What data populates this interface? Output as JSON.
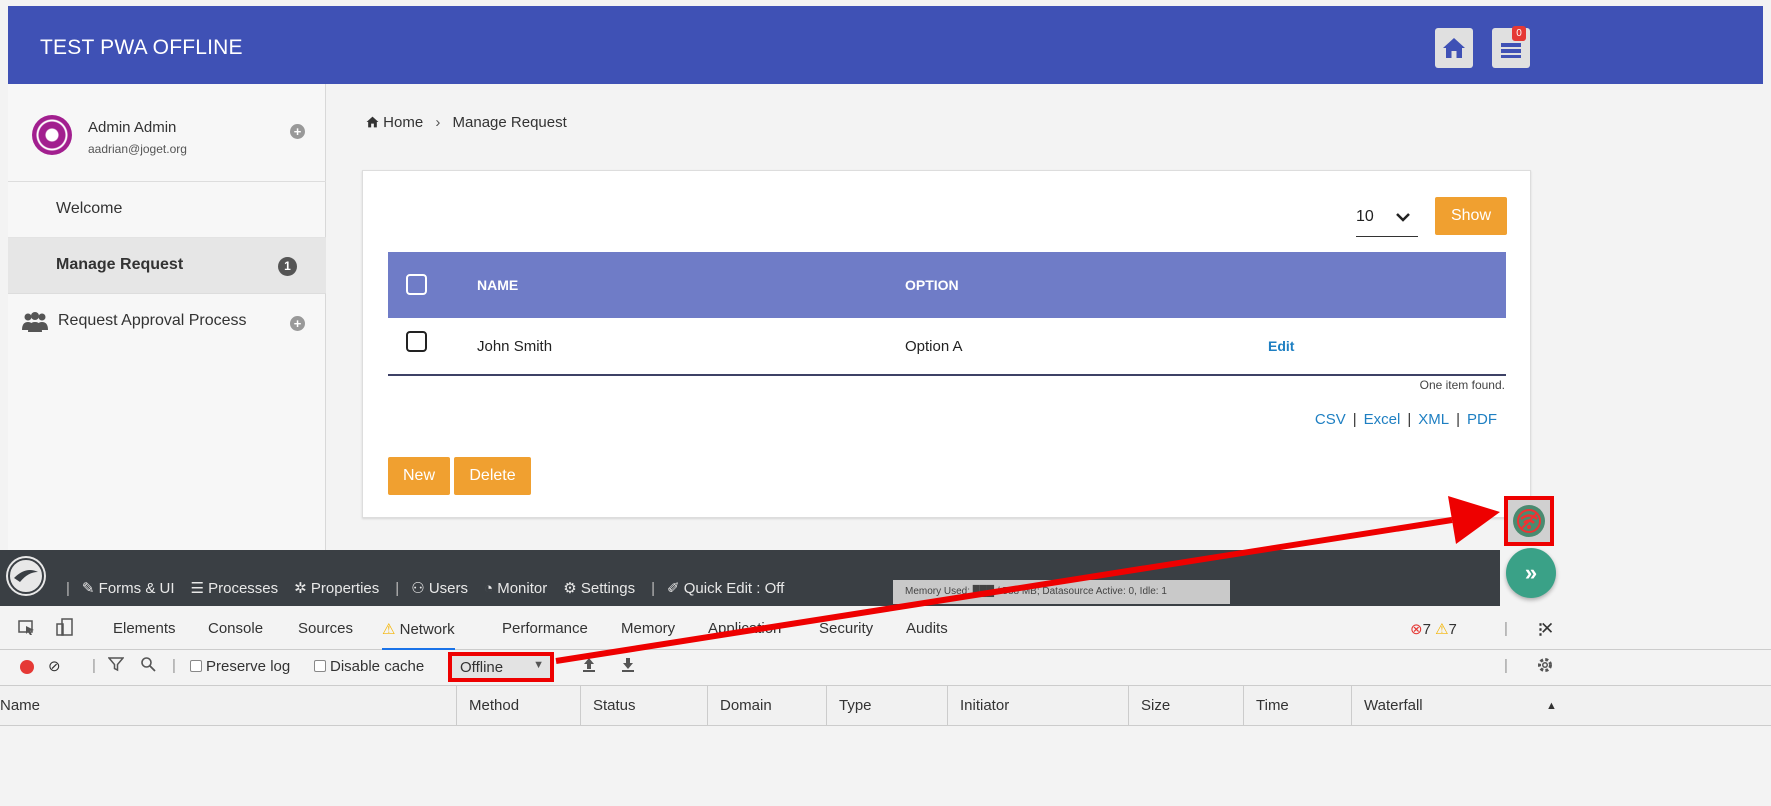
{
  "app": {
    "title": "TEST PWA OFFLINE",
    "inbox_count": "0"
  },
  "user": {
    "name": "Admin Admin",
    "email": "aadrian@joget.org"
  },
  "sidebar": {
    "items": [
      {
        "label": "Welcome"
      },
      {
        "label": "Manage Request",
        "badge": "1"
      },
      {
        "label": "Request Approval Process"
      }
    ]
  },
  "breadcrumb": {
    "home": "Home",
    "separator": "›",
    "current": "Manage Request"
  },
  "list": {
    "page_size": "10",
    "show_label": "Show",
    "columns": [
      "NAME",
      "OPTION"
    ],
    "rows": [
      {
        "name": "John Smith",
        "option": "Option A",
        "action": "Edit"
      }
    ],
    "found_text": "One item found.",
    "exports": [
      "CSV",
      "Excel",
      "XML",
      "PDF"
    ],
    "new_label": "New",
    "delete_label": "Delete"
  },
  "admin_bar": {
    "forms": "Forms & UI",
    "processes": "Processes",
    "properties": "Properties",
    "users": "Users",
    "monitor": "Monitor",
    "settings": "Settings",
    "quick_edit": "Quick Edit : Off",
    "memory": "Memory Used: ███ / 588 MB; Datasource Active: 0, Idle: 1"
  },
  "devtools": {
    "tabs": [
      "Elements",
      "Console",
      "Sources",
      "Network",
      "Performance",
      "Memory",
      "Application",
      "Security",
      "Audits"
    ],
    "errors": "7",
    "warnings": "7",
    "preserve_log": "Preserve log",
    "disable_cache": "Disable cache",
    "throttling": "Offline",
    "columns": [
      "Name",
      "Method",
      "Status",
      "Domain",
      "Type",
      "Initiator",
      "Size",
      "Time",
      "Waterfall"
    ]
  },
  "colors": {
    "header": "#3f51b5",
    "table_head": "#6f7cc7",
    "accent_orange": "#f0a030",
    "highlight": "#e00000"
  }
}
